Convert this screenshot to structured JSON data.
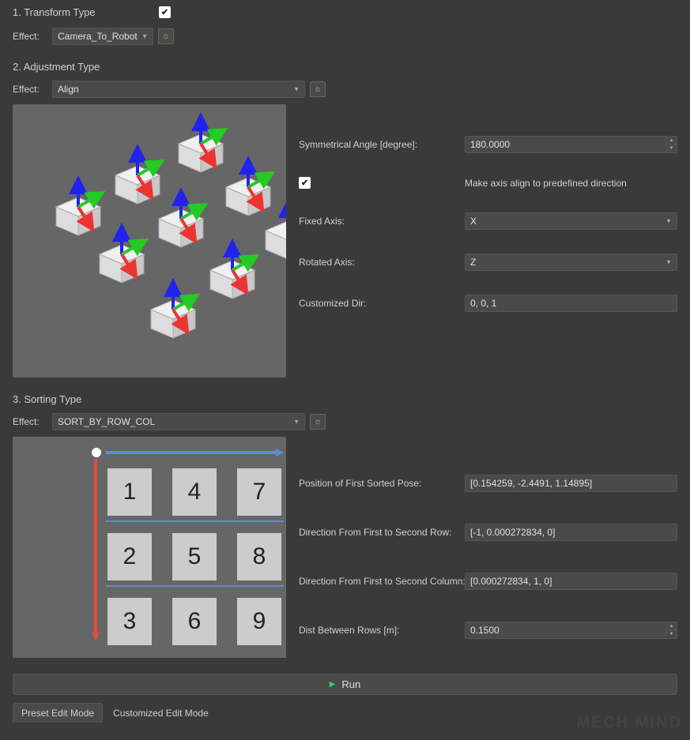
{
  "section1": {
    "title": "1. Transform Type",
    "checked": true,
    "effect_label": "Effect:",
    "effect_value": "Camera_To_Robot"
  },
  "section2": {
    "title": "2. Adjustment Type",
    "effect_label": "Effect:",
    "effect_value": "Align",
    "sym_angle_label": "Symmetrical Angle [degree]:",
    "sym_angle_value": "180.0000",
    "make_axis_label": "Make axis align to predefined direction",
    "make_axis_checked": true,
    "fixed_axis_label": "Fixed Axis:",
    "fixed_axis_value": "X",
    "rotated_axis_label": "Rotated Axis:",
    "rotated_axis_value": "Z",
    "custom_dir_label": "Customized Dir:",
    "custom_dir_value": "0, 0, 1"
  },
  "section3": {
    "title": "3. Sorting Type",
    "effect_label": "Effect:",
    "effect_value": "SORT_BY_ROW_COL",
    "pos_first_label": "Position of First Sorted Pose:",
    "pos_first_value": "[0.154259, -2.4491, 1.14895]",
    "dir_row_label": "Direction From First to Second Row:",
    "dir_row_value": "[-1, 0.000272834, 0]",
    "dir_col_label": "Direction From First to Second Column:",
    "dir_col_value": "[0.000272834, 1, 0]",
    "dist_label": "Dist Between Rows [m]:",
    "dist_value": "0.1500",
    "grid_cells": [
      "1",
      "4",
      "7",
      "2",
      "5",
      "8",
      "3",
      "6",
      "9"
    ]
  },
  "run_label": "Run",
  "tabs": {
    "preset": "Preset Edit Mode",
    "custom": "Customized Edit Mode"
  },
  "watermark": "MECH MIND"
}
